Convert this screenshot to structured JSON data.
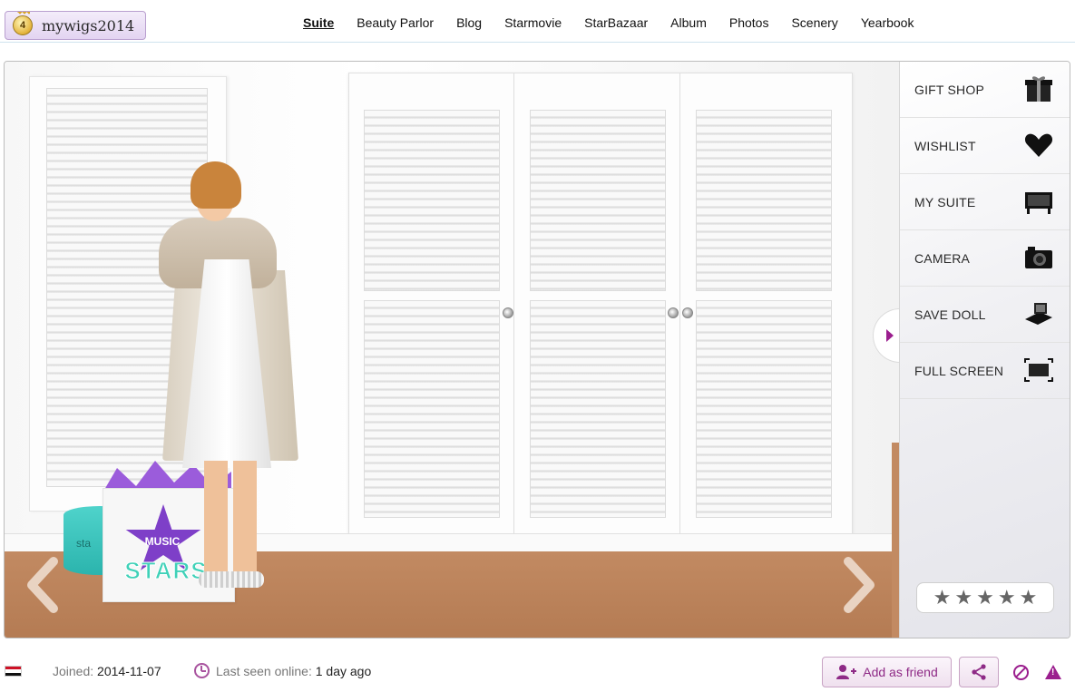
{
  "header": {
    "username": "mywigs2014",
    "level": "4",
    "nav": [
      {
        "label": "Suite",
        "active": true
      },
      {
        "label": "Beauty Parlor"
      },
      {
        "label": "Blog"
      },
      {
        "label": "Starmovie"
      },
      {
        "label": "StarBazaar"
      },
      {
        "label": "Album"
      },
      {
        "label": "Photos"
      },
      {
        "label": "Scenery"
      },
      {
        "label": "Yearbook"
      }
    ]
  },
  "scene": {
    "bag_text_top": "MUSIC",
    "bag_text_main": "STARS",
    "hatbox_text": "sta"
  },
  "sidebar": {
    "items": [
      {
        "label": "GIFT SHOP",
        "icon": "gift-box-icon"
      },
      {
        "label": "WISHLIST",
        "icon": "heart-icon"
      },
      {
        "label": "MY SUITE",
        "icon": "suite-icon"
      },
      {
        "label": "CAMERA",
        "icon": "camera-icon"
      },
      {
        "label": "SAVE DOLL",
        "icon": "save-doll-icon"
      },
      {
        "label": "FULL SCREEN",
        "icon": "full-screen-icon"
      }
    ],
    "rating": {
      "stars": 5,
      "filled": 0
    }
  },
  "footer": {
    "joined_label": "Joined:",
    "joined_value": "2014-11-07",
    "last_seen_label": "Last seen online:",
    "last_seen_value": "1 day ago",
    "add_friend_label": "Add as friend"
  },
  "colors": {
    "accent": "#9b1e8e",
    "floor": "#c28a62",
    "bag_teal": "#3fd1b8",
    "bag_purple": "#7e3fc8"
  }
}
